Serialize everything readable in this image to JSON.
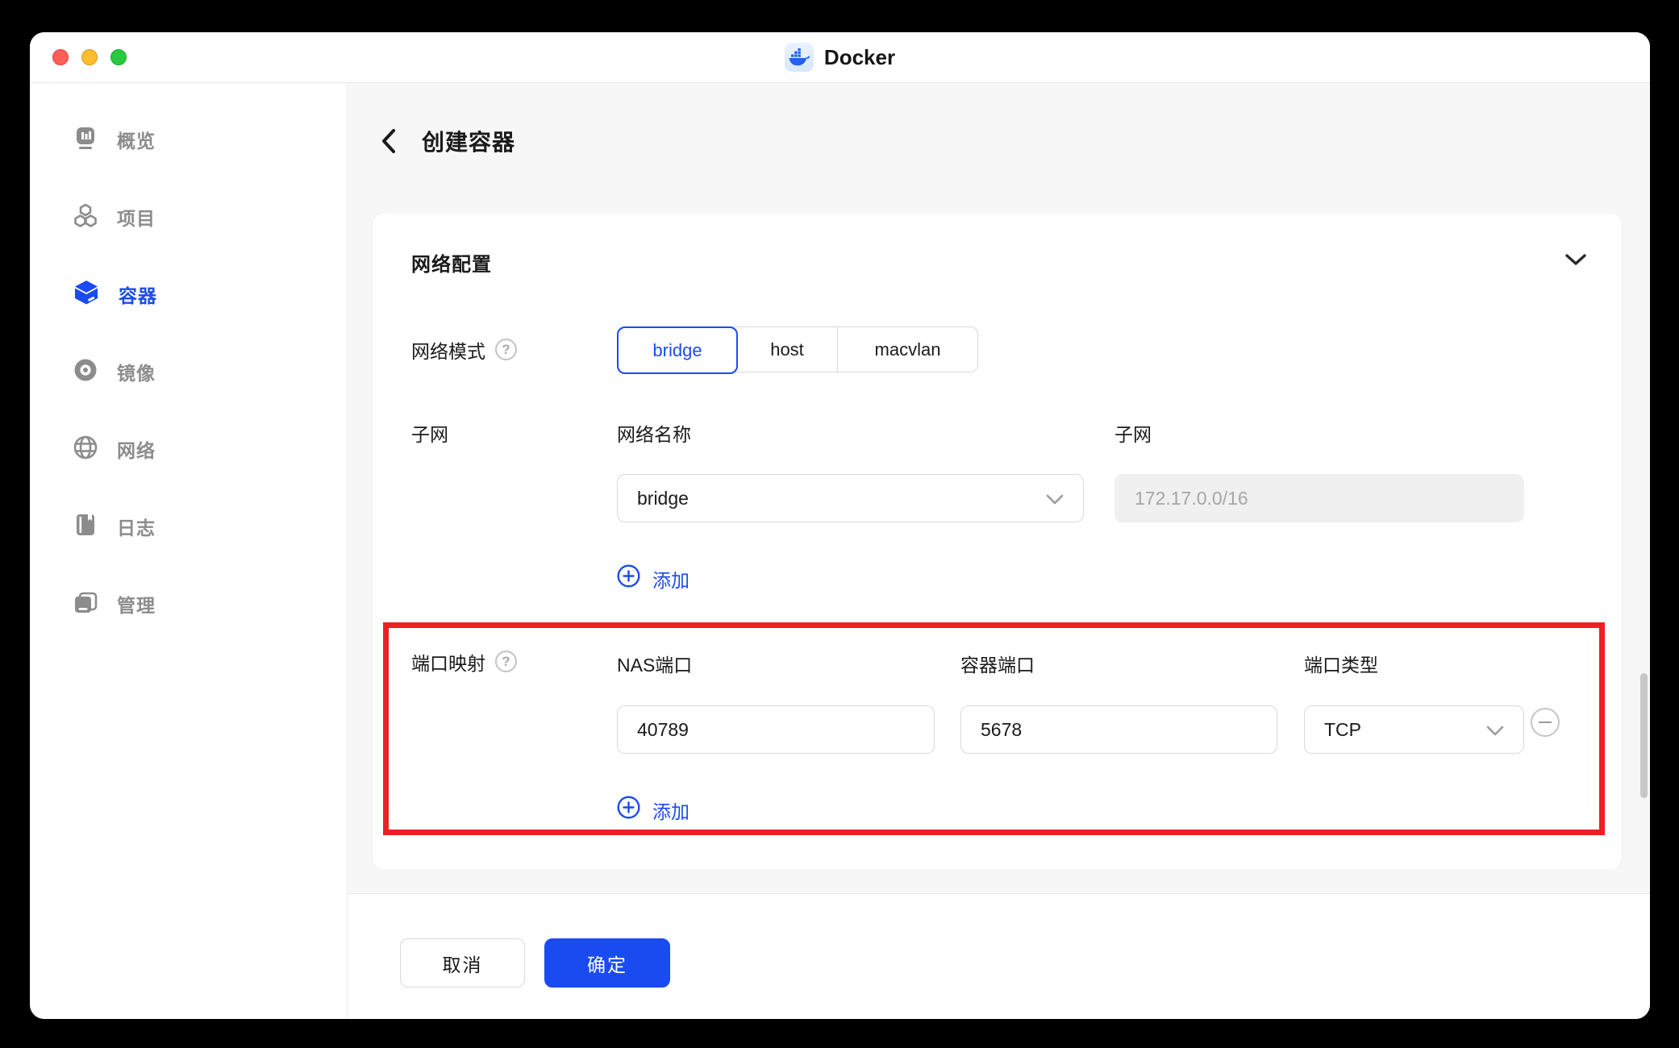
{
  "colors": {
    "accent": "#1a4bf0",
    "annotation_red": "#ed2024",
    "docker_blue": "#1d63ed"
  },
  "titlebar": {
    "app_title": "Docker"
  },
  "sidebar": {
    "items": [
      {
        "label": "概览",
        "icon": "overview-icon",
        "active": false
      },
      {
        "label": "项目",
        "icon": "projects-icon",
        "active": false
      },
      {
        "label": "容器",
        "icon": "containers-icon",
        "active": true
      },
      {
        "label": "镜像",
        "icon": "images-icon",
        "active": false
      },
      {
        "label": "网络",
        "icon": "network-icon",
        "active": false
      },
      {
        "label": "日志",
        "icon": "logs-icon",
        "active": false
      },
      {
        "label": "管理",
        "icon": "manage-icon",
        "active": false
      }
    ]
  },
  "page": {
    "title": "创建容器"
  },
  "card": {
    "section_title": "网络配置",
    "network_mode": {
      "label": "网络模式",
      "options": [
        "bridge",
        "host",
        "macvlan"
      ],
      "selected": "bridge"
    },
    "subnet_row": {
      "label": "子网",
      "name_label": "网络名称",
      "name_value": "bridge",
      "subnet_label": "子网",
      "subnet_value": "172.17.0.0/16"
    },
    "add_network_label": "添加",
    "port_mapping": {
      "label": "端口映射",
      "nas_port_label": "NAS端口",
      "nas_port_value": "40789",
      "container_port_label": "容器端口",
      "container_port_value": "5678",
      "port_type_label": "端口类型",
      "port_type_value": "TCP",
      "add_label": "添加"
    }
  },
  "footer": {
    "cancel_label": "取消",
    "confirm_label": "确定"
  },
  "misc": {
    "help_glyph": "?"
  }
}
